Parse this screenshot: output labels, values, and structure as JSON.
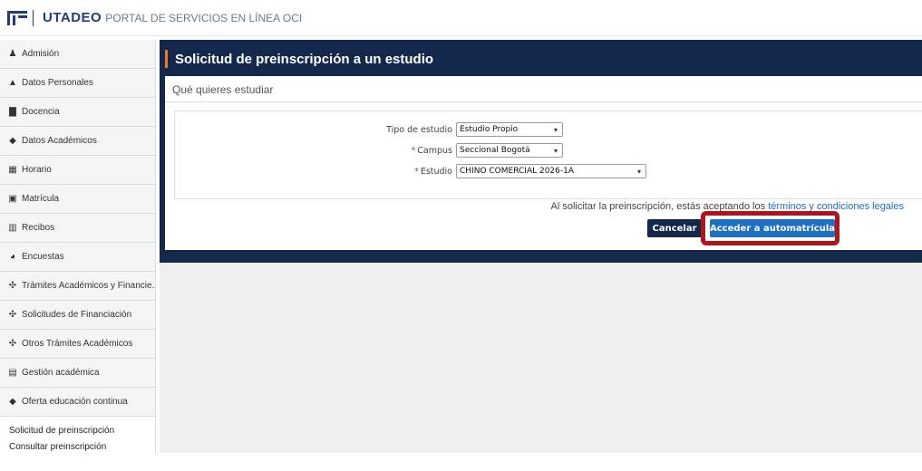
{
  "header": {
    "logo_text": "UTADEO",
    "portal_title": "PORTAL DE SERVICIOS EN LÍNEA OCI"
  },
  "sidebar": {
    "items": [
      {
        "label": "Admisión",
        "icon": "person-graduate-icon"
      },
      {
        "label": "Datos Personales",
        "icon": "person-icon"
      },
      {
        "label": "Docencia",
        "icon": "book-icon"
      },
      {
        "label": "Datos Académicos",
        "icon": "graduation-cap-icon"
      },
      {
        "label": "Horario",
        "icon": "calendar-icon"
      },
      {
        "label": "Matrícula",
        "icon": "enrollment-icon"
      },
      {
        "label": "Recibos",
        "icon": "barcode-icon"
      },
      {
        "label": "Encuestas",
        "icon": "pie-chart-icon"
      },
      {
        "label": "Trámites Académicos y Financie...",
        "icon": "network-icon"
      },
      {
        "label": "Solicitudes de Financiación",
        "icon": "network-icon"
      },
      {
        "label": "Otros Trámites Académicos",
        "icon": "network-icon"
      },
      {
        "label": "Gestión académica",
        "icon": "clipboard-icon"
      },
      {
        "label": "Oferta educación continua",
        "icon": "graduation-cap-icon"
      }
    ],
    "subitems": [
      "Solicitud de preinscripción",
      "Consultar preinscripción"
    ]
  },
  "panel": {
    "title": "Solicitud de preinscripción a un estudio",
    "subtitle": "Qué quieres estudiar"
  },
  "form": {
    "tipo_label": "Tipo de estudio",
    "tipo_value": "Estudio Propio",
    "campus_label": "Campus",
    "campus_value": "Seccional Bogotá",
    "estudio_label": "Estudio",
    "estudio_value": "CHINO COMERCIAL 2026-1A",
    "required_mark": "*"
  },
  "terms": {
    "text": "Al solicitar la preinscripción, estás aceptando los",
    "link": "términos y condiciones legales"
  },
  "buttons": {
    "cancel": "Cancelar",
    "accept": "Acceder a automatrícula"
  },
  "colors": {
    "navy": "#14284b",
    "accent_orange": "#f07a1f",
    "primary_blue": "#1f6fc4",
    "highlight_red": "#b0141c"
  }
}
